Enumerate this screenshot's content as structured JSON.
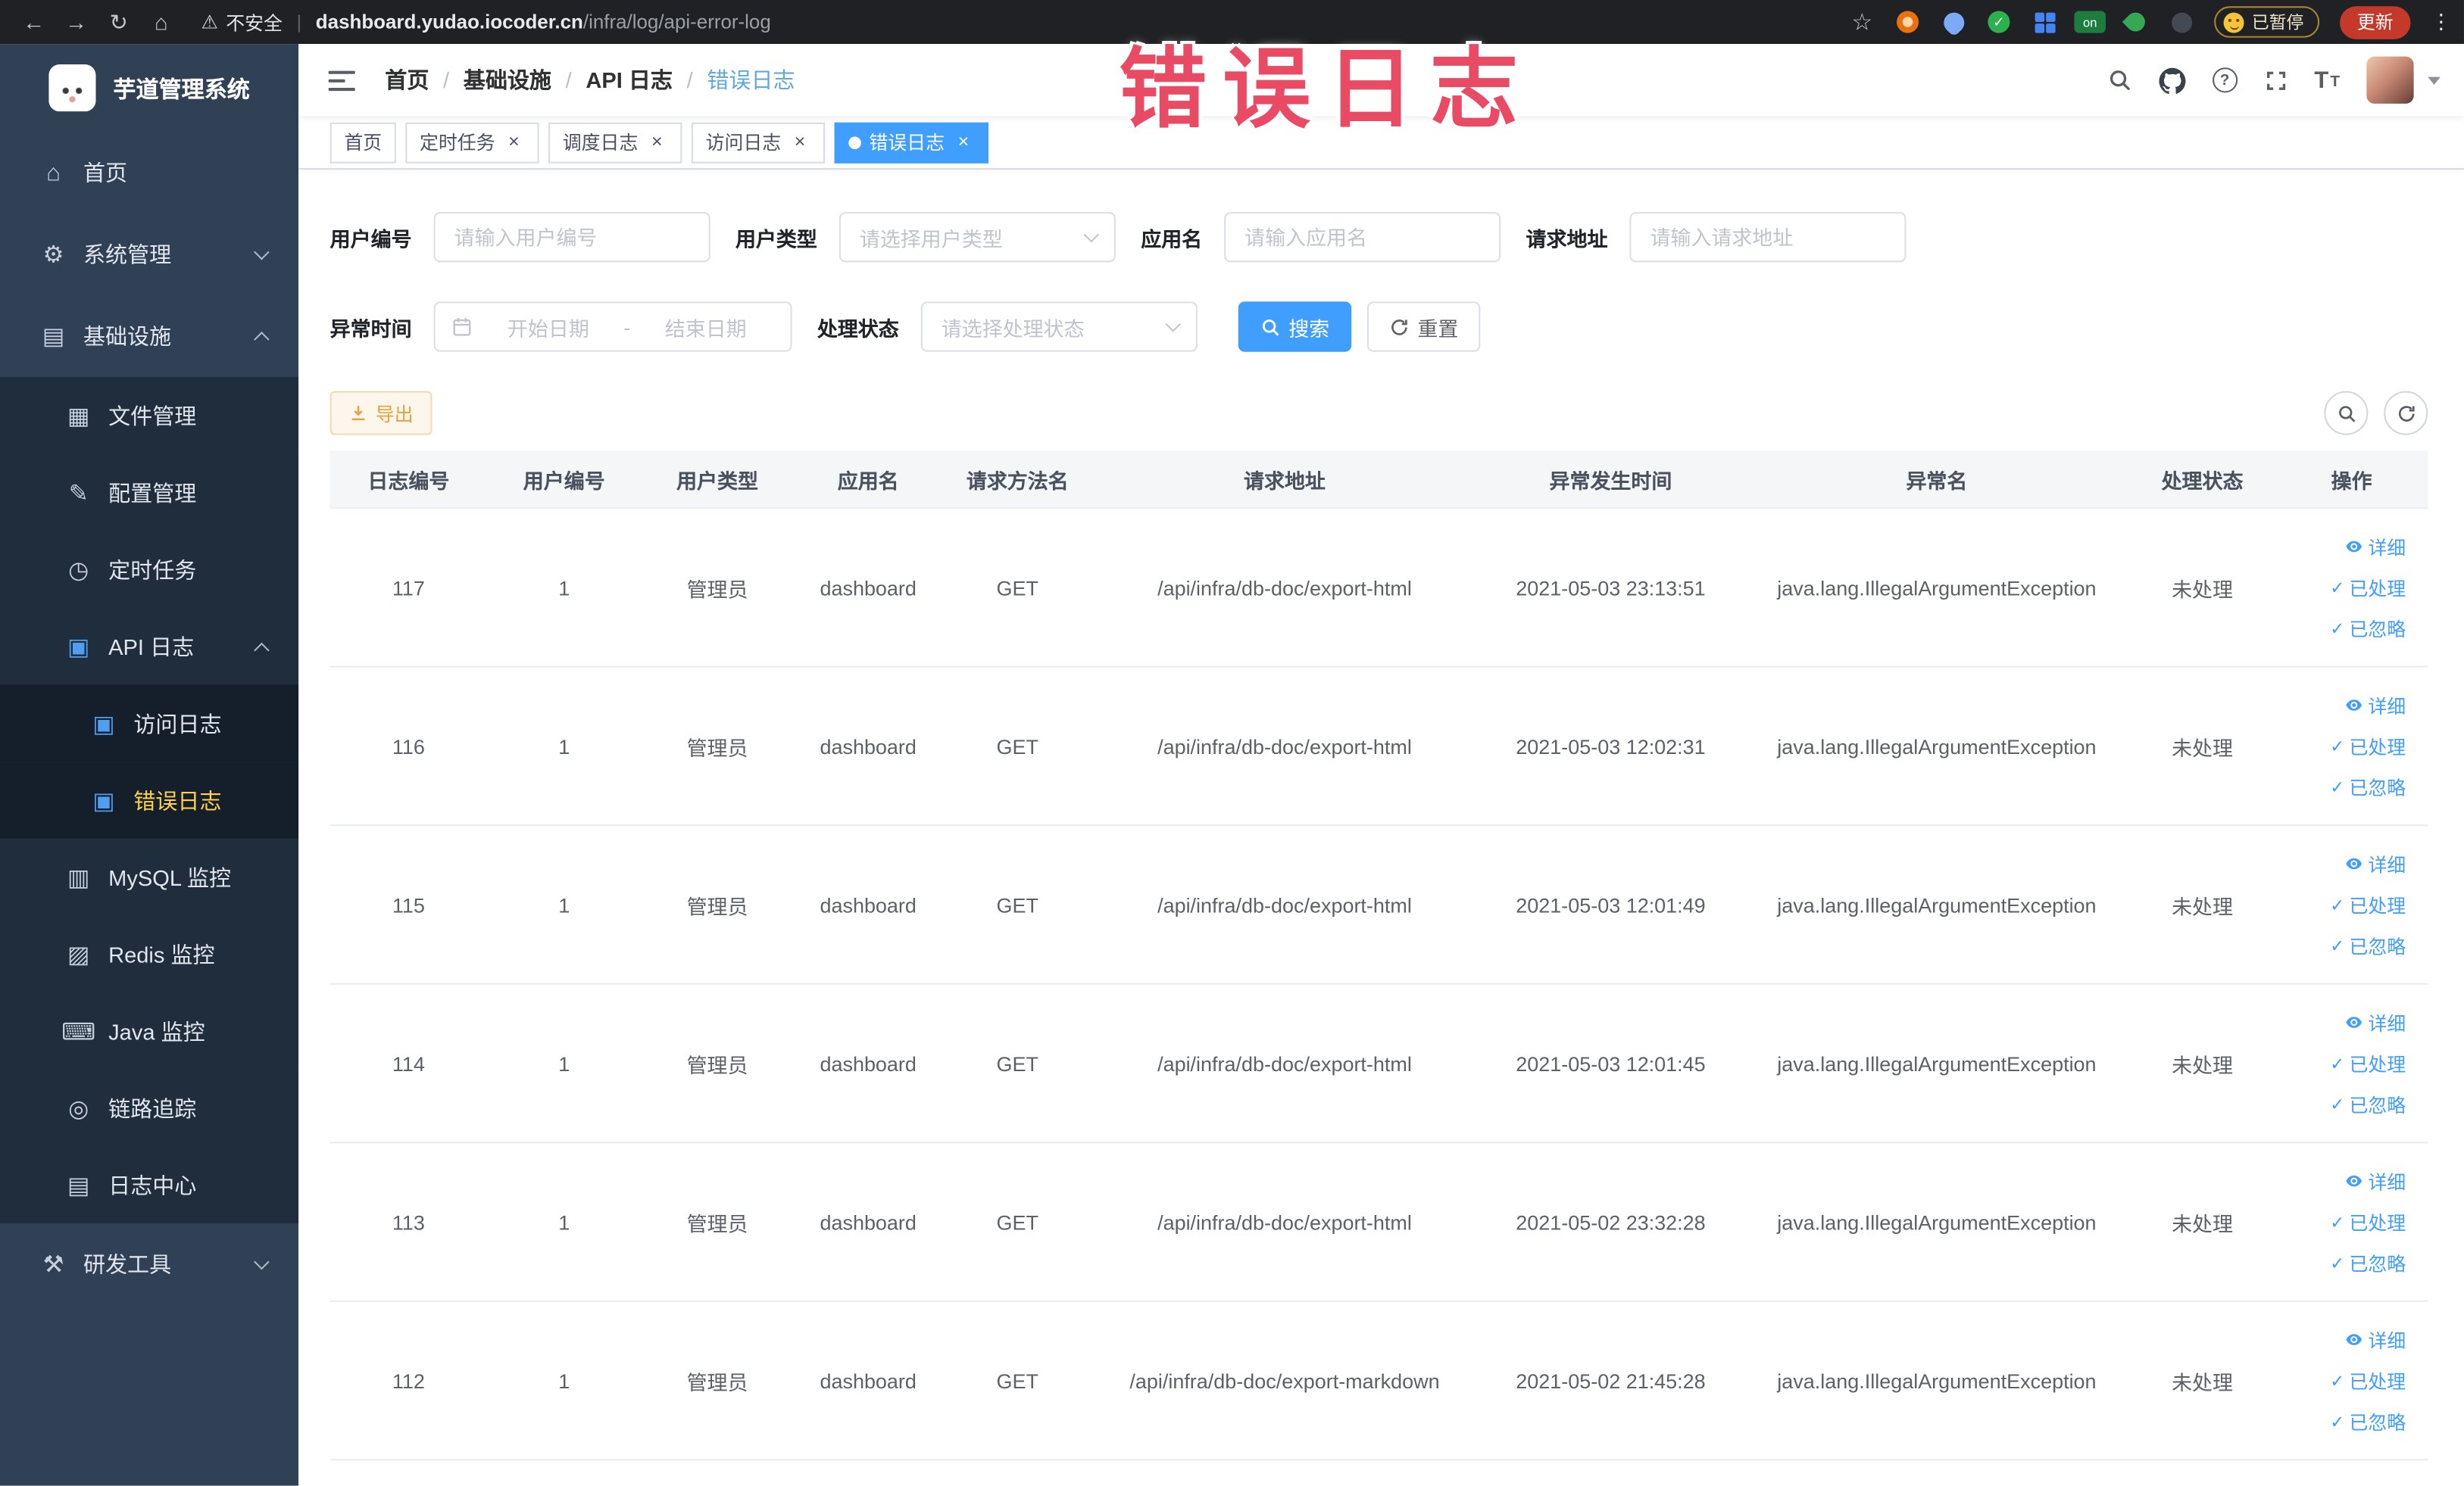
{
  "browser": {
    "security_label": "不安全",
    "url_host": "dashboard.yudao.iocoder.cn",
    "url_path": "/infra/log/api-error-log",
    "extension_on_badge": "on",
    "paused_badge": "已暂停",
    "update_button": "更新"
  },
  "annotation": "错误日志",
  "sidebar": {
    "logo_title": "芋道管理系统",
    "items": [
      {
        "name": "home",
        "label": "首页",
        "level": 1,
        "icon": "home-icon"
      },
      {
        "name": "system-management",
        "label": "系统管理",
        "level": 1,
        "icon": "gear-icon",
        "chevron": "down"
      },
      {
        "name": "infrastructure",
        "label": "基础设施",
        "level": 1,
        "icon": "infrastructure-icon",
        "chevron": "up"
      },
      {
        "name": "file-management",
        "label": "文件管理",
        "level": 2,
        "icon": "file-manage-icon"
      },
      {
        "name": "config-management",
        "label": "配置管理",
        "level": 2,
        "icon": "config-manage-icon"
      },
      {
        "name": "scheduled-jobs",
        "label": "定时任务",
        "level": 2,
        "icon": "scheduled-job-icon"
      },
      {
        "name": "api-log",
        "label": "API 日志",
        "level": 2,
        "icon": "api-log-icon",
        "chevron": "up",
        "accent": true
      },
      {
        "name": "access-log",
        "label": "访问日志",
        "level": 3,
        "icon": "access-log-icon",
        "accent": true
      },
      {
        "name": "error-log",
        "label": "错误日志",
        "level": 3,
        "icon": "error-log-icon",
        "accent": true,
        "active": true
      },
      {
        "name": "mysql-monitor",
        "label": "MySQL 监控",
        "level": 2,
        "icon": "mysql-monitor-icon"
      },
      {
        "name": "redis-monitor",
        "label": "Redis 监控",
        "level": 2,
        "icon": "redis-monitor-icon"
      },
      {
        "name": "java-monitor",
        "label": "Java 监控",
        "level": 2,
        "icon": "java-monitor-icon"
      },
      {
        "name": "trace",
        "label": "链路追踪",
        "level": 2,
        "icon": "trace-icon"
      },
      {
        "name": "log-center",
        "label": "日志中心",
        "level": 2,
        "icon": "log-center-icon"
      },
      {
        "name": "dev-tools",
        "label": "研发工具",
        "level": 1,
        "icon": "dev-tools-icon",
        "chevron": "down"
      }
    ]
  },
  "navbar": {
    "breadcrumb": [
      "首页",
      "基础设施",
      "API 日志",
      "错误日志"
    ]
  },
  "tabs": [
    {
      "name": "home",
      "label": "首页",
      "closable": false,
      "active": false
    },
    {
      "name": "scheduled-jobs",
      "label": "定时任务",
      "closable": true,
      "active": false
    },
    {
      "name": "dispatch-log",
      "label": "调度日志",
      "closable": true,
      "active": false
    },
    {
      "name": "access-log",
      "label": "访问日志",
      "closable": true,
      "active": false
    },
    {
      "name": "error-log",
      "label": "错误日志",
      "closable": true,
      "active": true
    }
  ],
  "filters": {
    "user_id": {
      "label": "用户编号",
      "placeholder": "请输入用户编号",
      "value": ""
    },
    "user_type": {
      "label": "用户类型",
      "placeholder": "请选择用户类型"
    },
    "app_name": {
      "label": "应用名",
      "placeholder": "请输入应用名",
      "value": ""
    },
    "request_url": {
      "label": "请求地址",
      "placeholder": "请输入请求地址",
      "value": ""
    },
    "exception_time": {
      "label": "异常时间",
      "start_placeholder": "开始日期",
      "separator": "-",
      "end_placeholder": "结束日期"
    },
    "process_status": {
      "label": "处理状态",
      "placeholder": "请选择处理状态"
    },
    "search_button": "搜索",
    "reset_button": "重置"
  },
  "toolbar": {
    "export_button": "导出"
  },
  "table": {
    "columns": [
      "日志编号",
      "用户编号",
      "用户类型",
      "应用名",
      "请求方法名",
      "请求地址",
      "异常发生时间",
      "异常名",
      "处理状态",
      "操作"
    ],
    "row_actions": [
      "详细",
      "已处理",
      "已忽略"
    ],
    "rows": [
      {
        "id": "117",
        "user_id": "1",
        "user_type": "管理员",
        "app_name": "dashboard",
        "method": "GET",
        "url": "/api/infra/db-doc/export-html",
        "time": "2021-05-03 23:13:51",
        "exception": "java.lang.IllegalArgumentException",
        "status": "未处理"
      },
      {
        "id": "116",
        "user_id": "1",
        "user_type": "管理员",
        "app_name": "dashboard",
        "method": "GET",
        "url": "/api/infra/db-doc/export-html",
        "time": "2021-05-03 12:02:31",
        "exception": "java.lang.IllegalArgumentException",
        "status": "未处理"
      },
      {
        "id": "115",
        "user_id": "1",
        "user_type": "管理员",
        "app_name": "dashboard",
        "method": "GET",
        "url": "/api/infra/db-doc/export-html",
        "time": "2021-05-03 12:01:49",
        "exception": "java.lang.IllegalArgumentException",
        "status": "未处理"
      },
      {
        "id": "114",
        "user_id": "1",
        "user_type": "管理员",
        "app_name": "dashboard",
        "method": "GET",
        "url": "/api/infra/db-doc/export-html",
        "time": "2021-05-03 12:01:45",
        "exception": "java.lang.IllegalArgumentException",
        "status": "未处理"
      },
      {
        "id": "113",
        "user_id": "1",
        "user_type": "管理员",
        "app_name": "dashboard",
        "method": "GET",
        "url": "/api/infra/db-doc/export-html",
        "time": "2021-05-02 23:32:28",
        "exception": "java.lang.IllegalArgumentException",
        "status": "未处理"
      },
      {
        "id": "112",
        "user_id": "1",
        "user_type": "管理员",
        "app_name": "dashboard",
        "method": "GET",
        "url": "/api/infra/db-doc/export-markdown",
        "time": "2021-05-02 21:45:28",
        "exception": "java.lang.IllegalArgumentException",
        "status": "未处理"
      }
    ]
  }
}
